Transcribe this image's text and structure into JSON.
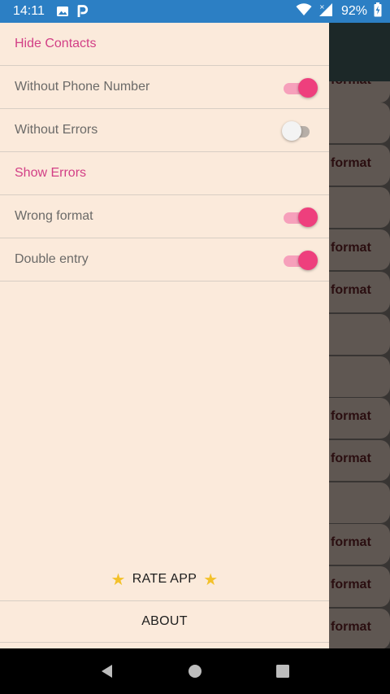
{
  "status_bar": {
    "time": "14:11",
    "battery": "92%",
    "icons": [
      "image-icon",
      "parking-icon",
      "wifi-icon",
      "signal-icon",
      "battery-icon"
    ],
    "color": "#2c7fc4"
  },
  "drawer": {
    "sections": [
      {
        "header": "Hide Contacts",
        "items": [
          {
            "label": "Without Phone Number",
            "on": true
          },
          {
            "label": "Without Errors",
            "on": false
          }
        ]
      },
      {
        "header": "Show Errors",
        "items": [
          {
            "label": "Wrong format",
            "on": true
          },
          {
            "label": "Double entry",
            "on": true
          }
        ]
      }
    ],
    "rate_label": "RATE APP",
    "about_label": "ABOUT",
    "accent_color": "#ee3f7d",
    "header_color": "#d23f86",
    "background": "#fbeadb"
  },
  "background_list": {
    "row_text": "format"
  },
  "nav_bar": {
    "buttons": [
      "back-icon",
      "home-icon",
      "recents-icon"
    ]
  }
}
